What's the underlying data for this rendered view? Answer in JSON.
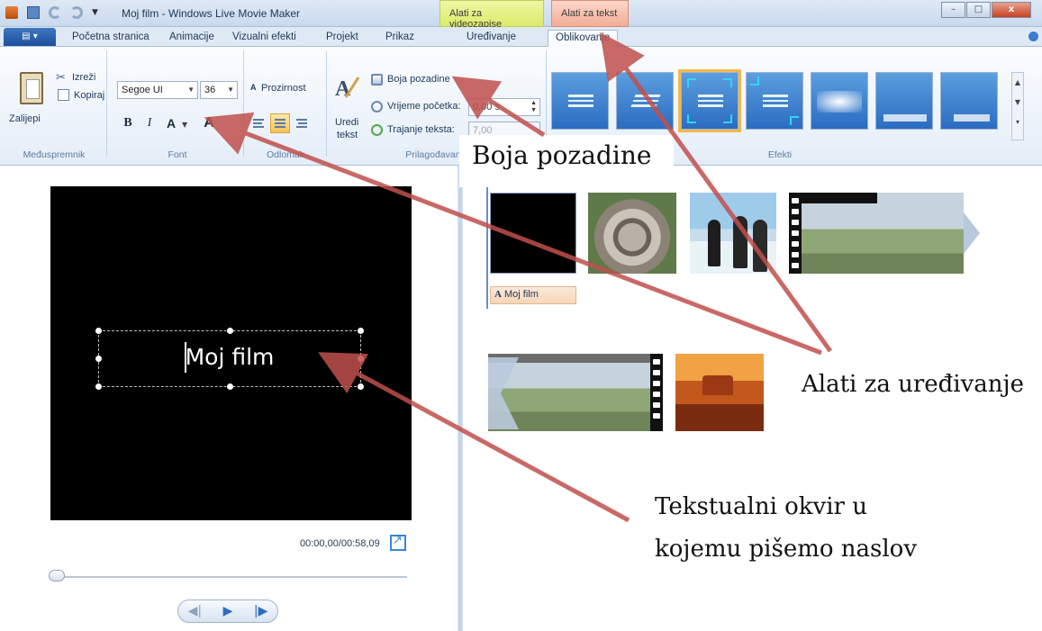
{
  "window": {
    "title": "Moj film - Windows Live Movie Maker",
    "context_tabs": [
      "Alati za videozapise",
      "Alati za tekst"
    ],
    "controls": {
      "minimize": "–",
      "maximize": "□",
      "close": "x"
    }
  },
  "ribbon_tabs": {
    "file": "▤ ▾",
    "items": [
      "Početna stranica",
      "Animacije",
      "Vizualni efekti",
      "Projekt",
      "Prikaz",
      "Uređivanje",
      "Oblikovanje"
    ],
    "active": "Oblikovanje"
  },
  "clipboard_group": {
    "label": "Međuspremnik",
    "paste": "Zalijepi",
    "cut": "Izreži",
    "copy": "Kopiraj"
  },
  "font_group": {
    "label": "Font",
    "font_name": "Segoe UI",
    "font_size": "36",
    "bold": "B",
    "italic": "I",
    "font_color": "A",
    "grow": "A"
  },
  "paragraph_group": {
    "label": "Odlomak",
    "transparency": "Prozirnost"
  },
  "adjust_group": {
    "label": "Prilagođavanje",
    "edit_text": [
      "Uredi",
      "tekst"
    ],
    "background_color": "Boja pozadine",
    "start_time_label": "Vrijeme početka:",
    "start_time_value": "0,00 s",
    "duration_label": "Trajanje teksta:",
    "duration_value": "7,00"
  },
  "effects_group": {
    "label": "Efekti",
    "selected_index": 2,
    "count": 7
  },
  "preview": {
    "title_text": "Moj film",
    "timecode": "00:00,00/00:58,09",
    "seek_position": 0
  },
  "storyboard": {
    "title_caption": "Moj film",
    "caption_icon": "A",
    "clips": [
      "title-black",
      "koala",
      "penguins",
      "desert-birds",
      "desert-birds-end",
      "desert"
    ]
  },
  "annotations": {
    "boja": "Boja pozadine",
    "alati": "Alati za uređivanje",
    "tekst_line1": "Tekstualni okvir u",
    "tekst_line2": "kojemu pišemo naslov"
  },
  "colors": {
    "arrow": "#c0504d",
    "accent": "#f2b84a",
    "ribbon": "#dfe9f5"
  }
}
